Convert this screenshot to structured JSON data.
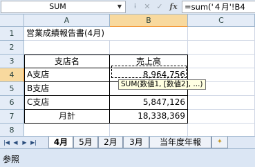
{
  "formula_bar": {
    "name_box": "SUM",
    "dropdown_icon": "chevron-down-icon",
    "more_icon": "dots-icon",
    "cancel_icon": "x-icon",
    "enter_icon": "check-icon",
    "fx_label": "fx",
    "formula": "=sum('４月'!B4"
  },
  "columns": [
    "A",
    "B",
    "C"
  ],
  "rows": [
    "1",
    "2",
    "3",
    "4",
    "5",
    "6",
    "7",
    "8",
    "9"
  ],
  "cells": {
    "a1": "営業成績報告書(4月)",
    "a3": "支店名",
    "b3": "売上高",
    "a4": "A支店",
    "b4": "8,964,756",
    "a5": "B支店",
    "a6": "C支店",
    "b6": "5,847,126",
    "a7": "月計",
    "b7": "18,338,369"
  },
  "tooltip": "SUM(数値1, [数値2], ...)",
  "sheet_tabs": [
    "4月",
    "5月",
    "2月",
    "3月",
    "当年度年報"
  ],
  "active_tab": "4月",
  "status": "参照",
  "colors": {
    "selected_header": "#f8d99e",
    "header": "#e4ecf7",
    "gridline": "#d0d7e5",
    "tooltip_bg": "#ffffe1"
  }
}
